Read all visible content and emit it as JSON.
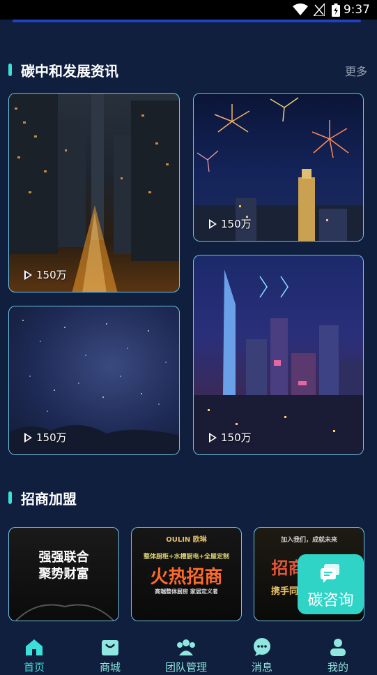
{
  "status_bar": {
    "time": "9:37"
  },
  "section_news": {
    "title": "碳中和发展资讯",
    "more_label": "更多"
  },
  "news_cards": [
    {
      "views": "150万",
      "scene": "city-street-night"
    },
    {
      "views": "150万",
      "scene": "fireworks-city"
    },
    {
      "views": "150万",
      "scene": "starry-sky"
    },
    {
      "views": "150万",
      "scene": "city-skyline-night"
    }
  ],
  "section_join": {
    "title": "招商加盟"
  },
  "join_banners": [
    {
      "line1": "强强联合",
      "line2": "聚势财富"
    },
    {
      "brand": "OULIN 欧琳",
      "slogan": "整体厨柜+水槽厨电+全屋定制",
      "headline": "火热招商",
      "sub": "高端整体厨房 家居定义者"
    },
    {
      "top_text": "加入我们，成就未来",
      "headline": "招商",
      "sub": "携手同"
    }
  ],
  "floating_button": {
    "label": "碳咨询",
    "icon": "chat-bubble-icon"
  },
  "tab_bar": [
    {
      "label": "首页",
      "icon": "home-icon",
      "active": true
    },
    {
      "label": "商城",
      "icon": "shop-bag-icon",
      "active": false
    },
    {
      "label": "团队管理",
      "icon": "team-icon",
      "active": false
    },
    {
      "label": "消息",
      "icon": "message-icon",
      "active": false
    },
    {
      "label": "我的",
      "icon": "profile-icon",
      "active": false
    }
  ],
  "colors": {
    "background": "#0f1f3d",
    "accent": "#3be0d8",
    "card_border": "#6fc3e8",
    "fab": "#2fd4c6"
  }
}
